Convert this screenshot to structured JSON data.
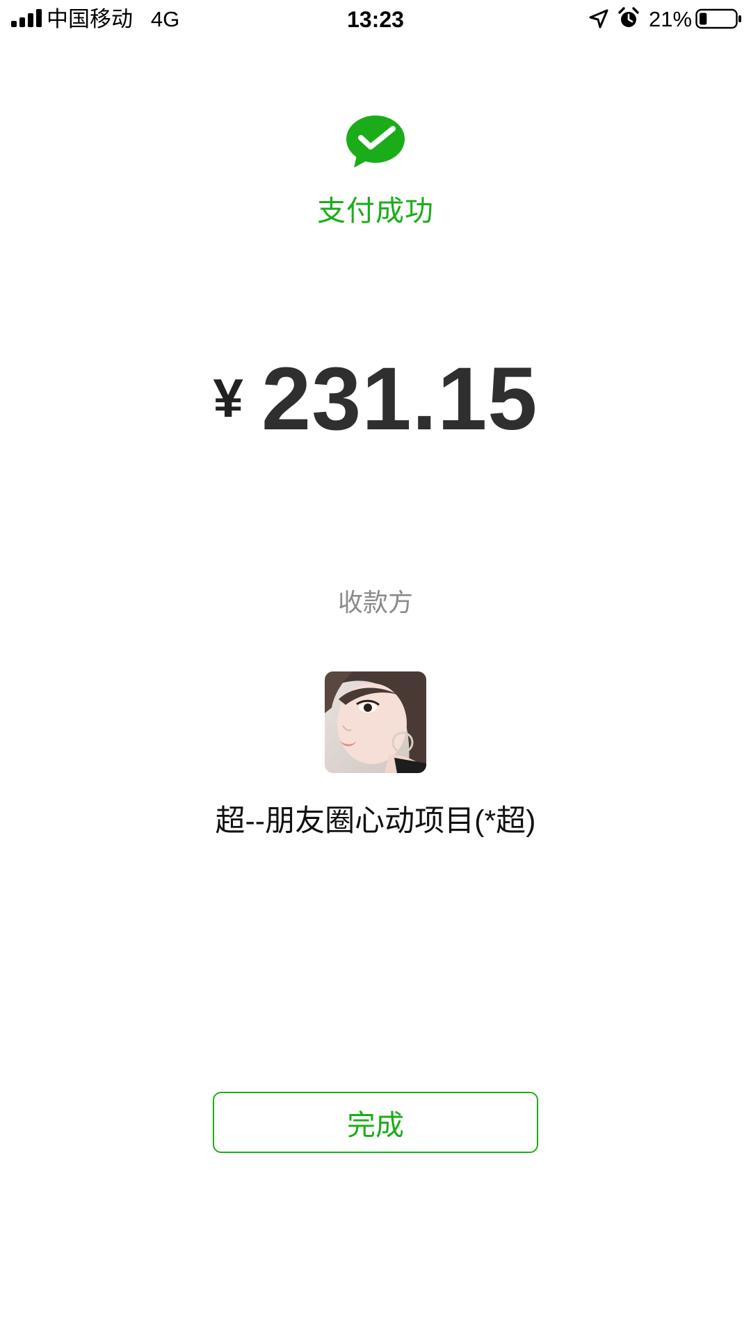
{
  "status_bar": {
    "carrier": "中国移动",
    "network": "4G",
    "time": "13:23",
    "battery_percent": "21%",
    "battery_level": 0.21,
    "icons": [
      "signal-icon",
      "location-icon",
      "alarm-icon",
      "battery-icon"
    ]
  },
  "result": {
    "title": "支付成功",
    "icon": "wechat-pay-success-icon"
  },
  "amount": {
    "currency": "¥",
    "value": "231.15"
  },
  "payee": {
    "label": "收款方",
    "name": "超--朋友圈心动项目(*超)"
  },
  "actions": {
    "done_label": "完成"
  },
  "colors": {
    "accent": "#1aad19",
    "amount_text": "#2f2f2f",
    "muted_text": "#8a8a8a",
    "background": "#ffffff"
  }
}
